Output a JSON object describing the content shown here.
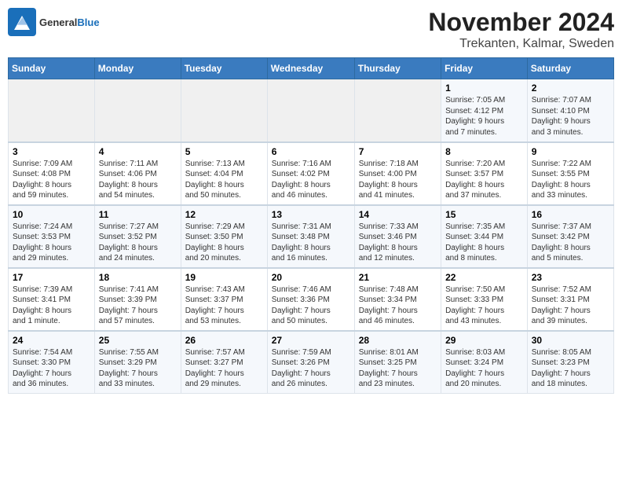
{
  "logo": {
    "general": "General",
    "blue": "Blue"
  },
  "title": "November 2024",
  "subtitle": "Trekanten, Kalmar, Sweden",
  "days_of_week": [
    "Sunday",
    "Monday",
    "Tuesday",
    "Wednesday",
    "Thursday",
    "Friday",
    "Saturday"
  ],
  "weeks": [
    [
      {
        "day": "",
        "info": ""
      },
      {
        "day": "",
        "info": ""
      },
      {
        "day": "",
        "info": ""
      },
      {
        "day": "",
        "info": ""
      },
      {
        "day": "",
        "info": ""
      },
      {
        "day": "1",
        "info": "Sunrise: 7:05 AM\nSunset: 4:12 PM\nDaylight: 9 hours\nand 7 minutes."
      },
      {
        "day": "2",
        "info": "Sunrise: 7:07 AM\nSunset: 4:10 PM\nDaylight: 9 hours\nand 3 minutes."
      }
    ],
    [
      {
        "day": "3",
        "info": "Sunrise: 7:09 AM\nSunset: 4:08 PM\nDaylight: 8 hours\nand 59 minutes."
      },
      {
        "day": "4",
        "info": "Sunrise: 7:11 AM\nSunset: 4:06 PM\nDaylight: 8 hours\nand 54 minutes."
      },
      {
        "day": "5",
        "info": "Sunrise: 7:13 AM\nSunset: 4:04 PM\nDaylight: 8 hours\nand 50 minutes."
      },
      {
        "day": "6",
        "info": "Sunrise: 7:16 AM\nSunset: 4:02 PM\nDaylight: 8 hours\nand 46 minutes."
      },
      {
        "day": "7",
        "info": "Sunrise: 7:18 AM\nSunset: 4:00 PM\nDaylight: 8 hours\nand 41 minutes."
      },
      {
        "day": "8",
        "info": "Sunrise: 7:20 AM\nSunset: 3:57 PM\nDaylight: 8 hours\nand 37 minutes."
      },
      {
        "day": "9",
        "info": "Sunrise: 7:22 AM\nSunset: 3:55 PM\nDaylight: 8 hours\nand 33 minutes."
      }
    ],
    [
      {
        "day": "10",
        "info": "Sunrise: 7:24 AM\nSunset: 3:53 PM\nDaylight: 8 hours\nand 29 minutes."
      },
      {
        "day": "11",
        "info": "Sunrise: 7:27 AM\nSunset: 3:52 PM\nDaylight: 8 hours\nand 24 minutes."
      },
      {
        "day": "12",
        "info": "Sunrise: 7:29 AM\nSunset: 3:50 PM\nDaylight: 8 hours\nand 20 minutes."
      },
      {
        "day": "13",
        "info": "Sunrise: 7:31 AM\nSunset: 3:48 PM\nDaylight: 8 hours\nand 16 minutes."
      },
      {
        "day": "14",
        "info": "Sunrise: 7:33 AM\nSunset: 3:46 PM\nDaylight: 8 hours\nand 12 minutes."
      },
      {
        "day": "15",
        "info": "Sunrise: 7:35 AM\nSunset: 3:44 PM\nDaylight: 8 hours\nand 8 minutes."
      },
      {
        "day": "16",
        "info": "Sunrise: 7:37 AM\nSunset: 3:42 PM\nDaylight: 8 hours\nand 5 minutes."
      }
    ],
    [
      {
        "day": "17",
        "info": "Sunrise: 7:39 AM\nSunset: 3:41 PM\nDaylight: 8 hours\nand 1 minute."
      },
      {
        "day": "18",
        "info": "Sunrise: 7:41 AM\nSunset: 3:39 PM\nDaylight: 7 hours\nand 57 minutes."
      },
      {
        "day": "19",
        "info": "Sunrise: 7:43 AM\nSunset: 3:37 PM\nDaylight: 7 hours\nand 53 minutes."
      },
      {
        "day": "20",
        "info": "Sunrise: 7:46 AM\nSunset: 3:36 PM\nDaylight: 7 hours\nand 50 minutes."
      },
      {
        "day": "21",
        "info": "Sunrise: 7:48 AM\nSunset: 3:34 PM\nDaylight: 7 hours\nand 46 minutes."
      },
      {
        "day": "22",
        "info": "Sunrise: 7:50 AM\nSunset: 3:33 PM\nDaylight: 7 hours\nand 43 minutes."
      },
      {
        "day": "23",
        "info": "Sunrise: 7:52 AM\nSunset: 3:31 PM\nDaylight: 7 hours\nand 39 minutes."
      }
    ],
    [
      {
        "day": "24",
        "info": "Sunrise: 7:54 AM\nSunset: 3:30 PM\nDaylight: 7 hours\nand 36 minutes."
      },
      {
        "day": "25",
        "info": "Sunrise: 7:55 AM\nSunset: 3:29 PM\nDaylight: 7 hours\nand 33 minutes."
      },
      {
        "day": "26",
        "info": "Sunrise: 7:57 AM\nSunset: 3:27 PM\nDaylight: 7 hours\nand 29 minutes."
      },
      {
        "day": "27",
        "info": "Sunrise: 7:59 AM\nSunset: 3:26 PM\nDaylight: 7 hours\nand 26 minutes."
      },
      {
        "day": "28",
        "info": "Sunrise: 8:01 AM\nSunset: 3:25 PM\nDaylight: 7 hours\nand 23 minutes."
      },
      {
        "day": "29",
        "info": "Sunrise: 8:03 AM\nSunset: 3:24 PM\nDaylight: 7 hours\nand 20 minutes."
      },
      {
        "day": "30",
        "info": "Sunrise: 8:05 AM\nSunset: 3:23 PM\nDaylight: 7 hours\nand 18 minutes."
      }
    ]
  ]
}
